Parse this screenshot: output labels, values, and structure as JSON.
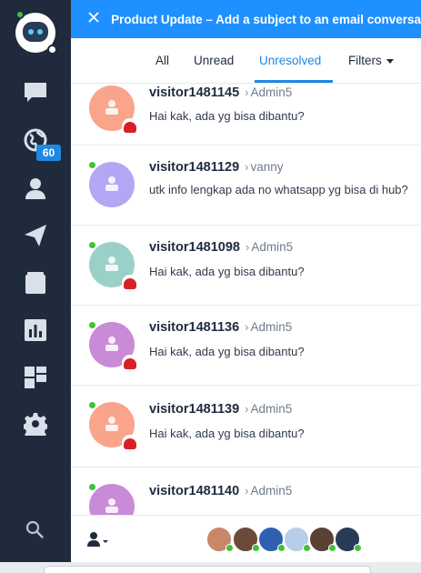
{
  "banner": {
    "close_icon": "close-icon",
    "text": "Product Update – Add a subject to an email conversa"
  },
  "sidebar": {
    "logo": "bot-avatar",
    "items": [
      {
        "icon": "chat-bubble-icon"
      },
      {
        "icon": "globe-icon",
        "badge": "60"
      },
      {
        "icon": "person-icon"
      },
      {
        "icon": "paper-plane-icon"
      },
      {
        "icon": "book-icon"
      },
      {
        "icon": "bar-chart-icon"
      },
      {
        "icon": "dashboard-icon"
      },
      {
        "icon": "gear-icon"
      }
    ],
    "search_icon": "search-icon"
  },
  "tabs": {
    "all": "All",
    "unread": "Unread",
    "unresolved": "Unresolved",
    "filters": "Filters"
  },
  "conversations": [
    {
      "visitor": "visitor1481145",
      "agent": "Admin5",
      "message": "Hai kak, ada yg bisa dibantu?",
      "avatar_color": "#f9a48b"
    },
    {
      "visitor": "visitor1481129",
      "agent": "vanny",
      "message": "utk info lengkap ada no whatsapp yg bisa di hub?",
      "avatar_color": "#b3a7f5"
    },
    {
      "visitor": "visitor1481098",
      "agent": "Admin5",
      "message": "Hai kak, ada yg bisa dibantu?",
      "avatar_color": "#9bd0c9"
    },
    {
      "visitor": "visitor1481136",
      "agent": "Admin5",
      "message": "Hai kak, ada yg bisa dibantu?",
      "avatar_color": "#c98ad8"
    },
    {
      "visitor": "visitor1481139",
      "agent": "Admin5",
      "message": "Hai kak, ada yg bisa dibantu?",
      "avatar_color": "#f9a48b"
    },
    {
      "visitor": "visitor1481140",
      "agent": "Admin5",
      "message": "",
      "avatar_color": "#c98ad8"
    }
  ],
  "colors": {
    "sidebar": "#1f2b3d",
    "accent": "#1e88e5",
    "online": "#42c13b",
    "flag": "#d91f26"
  }
}
